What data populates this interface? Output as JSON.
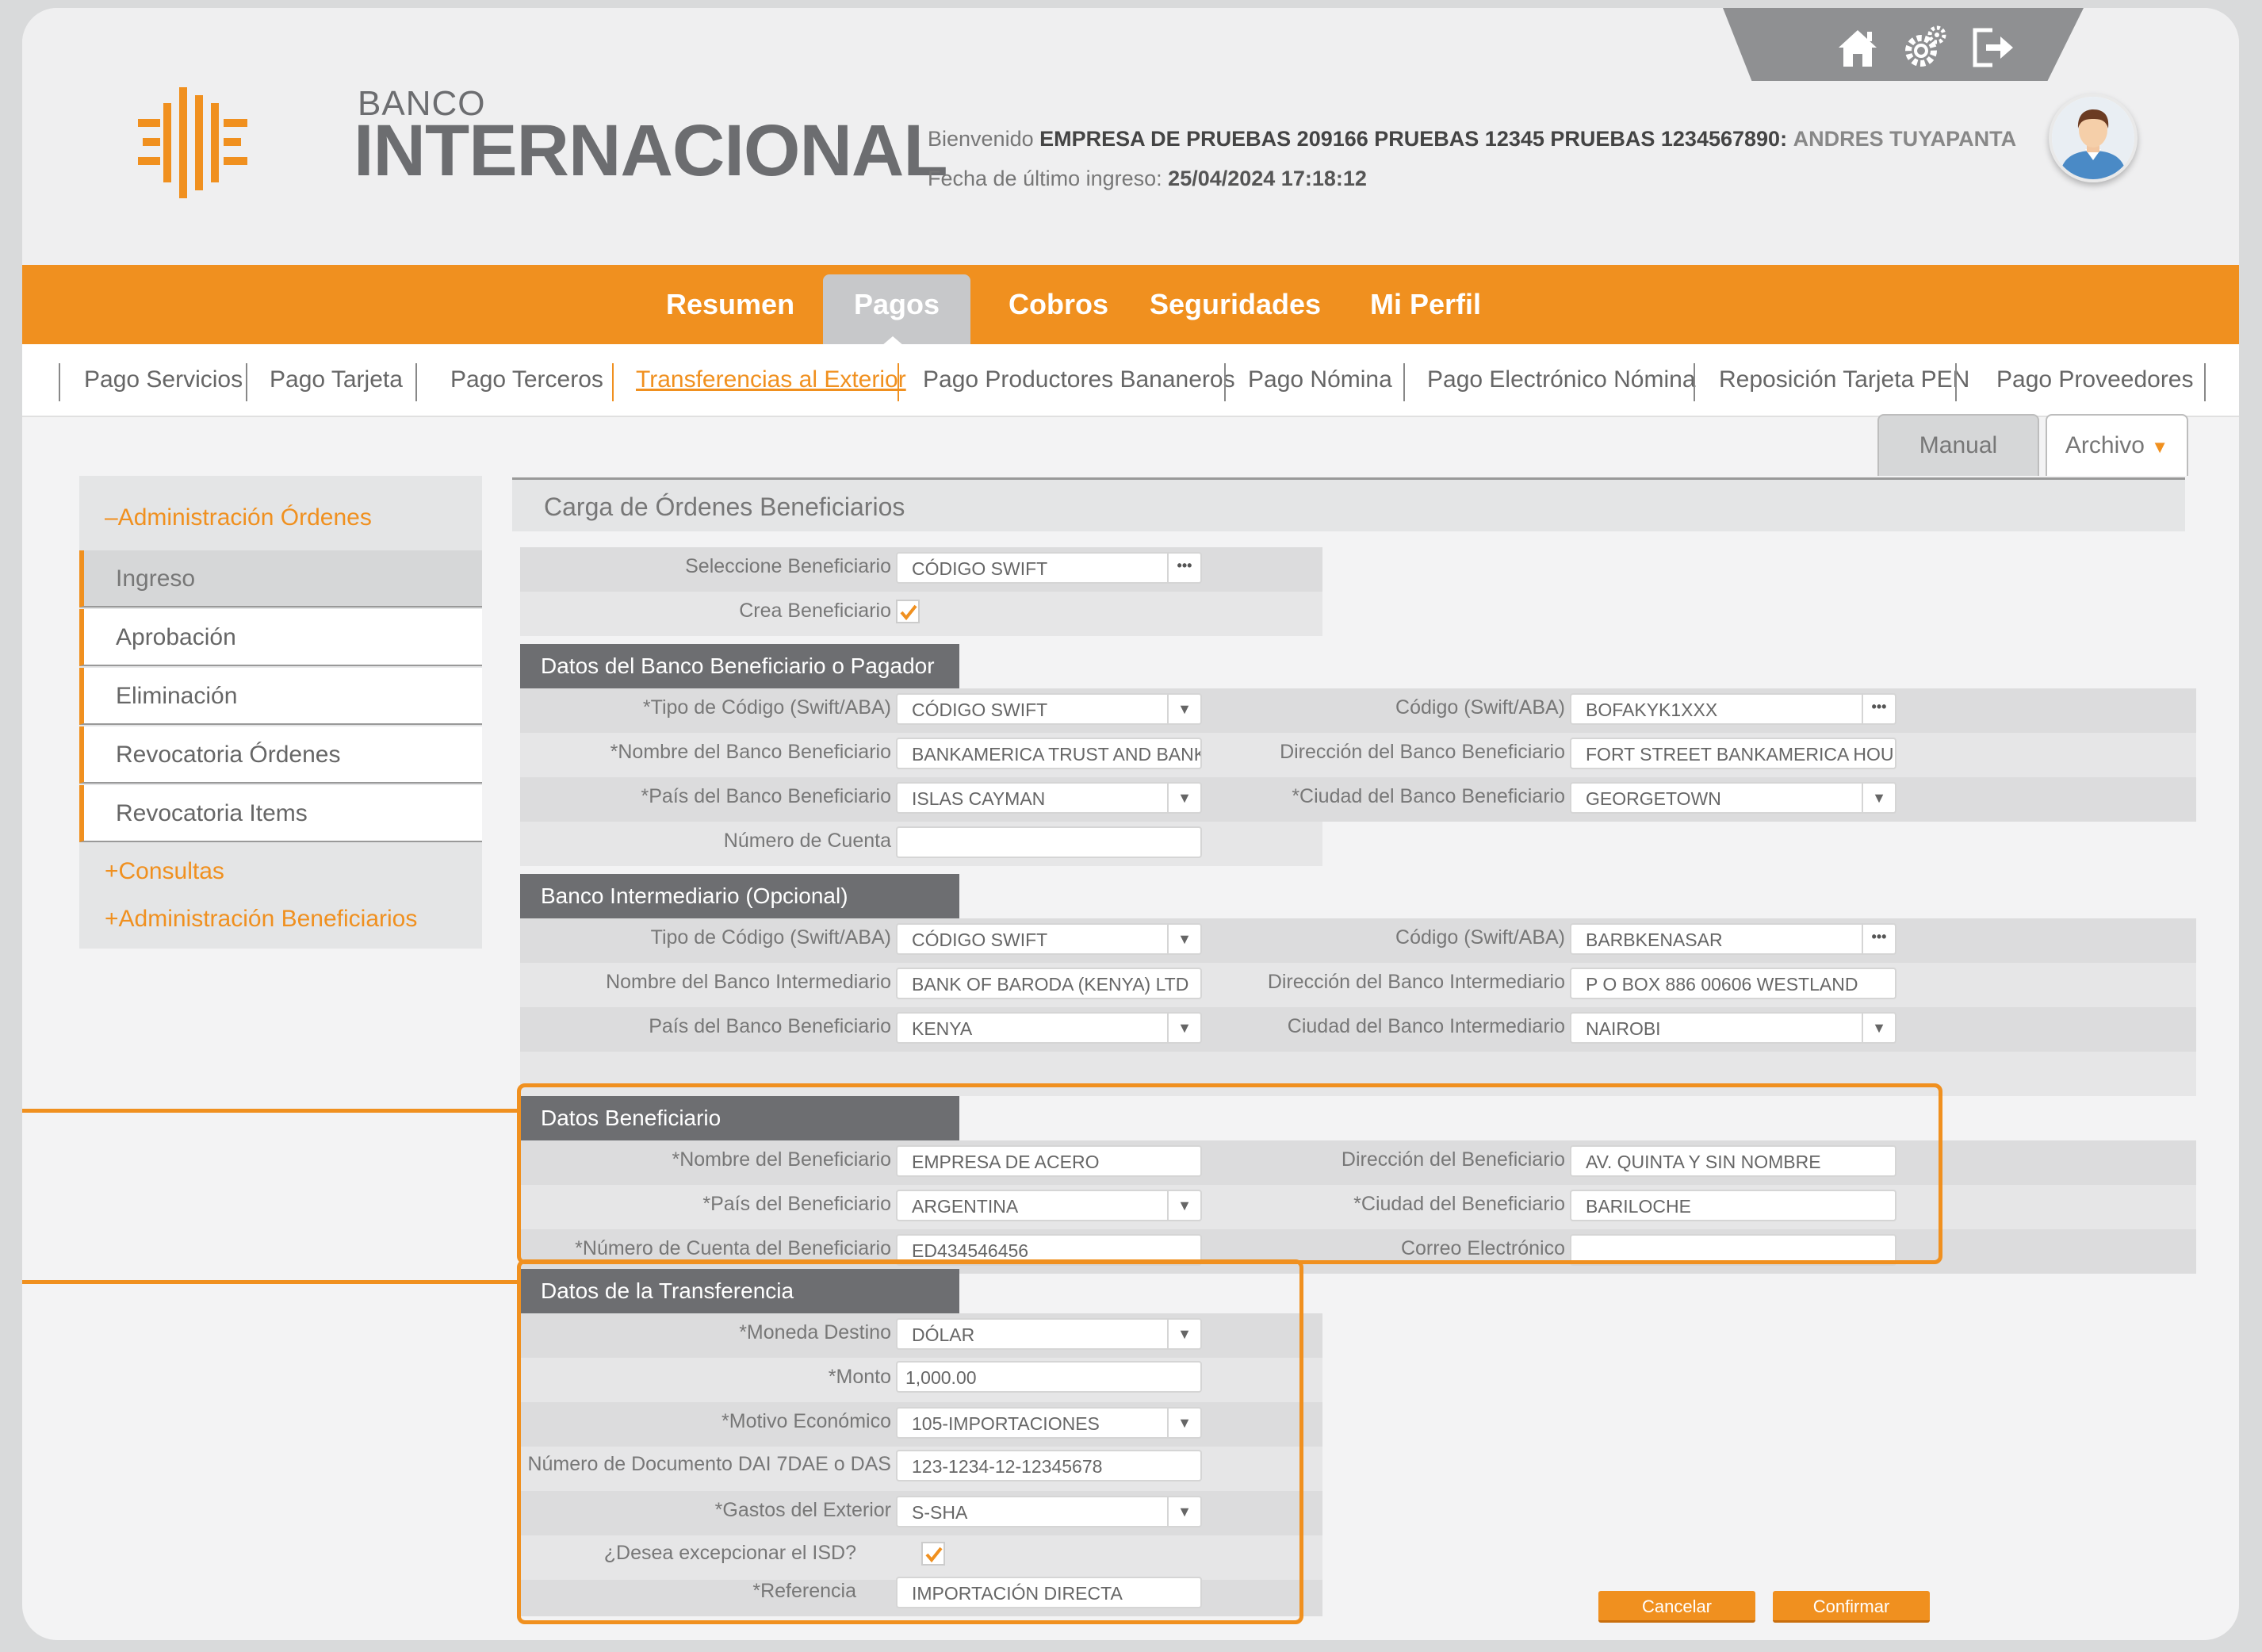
{
  "header": {
    "logo_top": "BANCO",
    "logo_name": "INTERNACIONAL",
    "welcome_prefix": "Bienvenido",
    "company": "EMPRESA DE PRUEBAS 209166 PRUEBAS 12345 PRUEBAS 1234567890:",
    "user": "ANDRES TUYAPANTA",
    "last_login_label": "Fecha de último ingreso:",
    "last_login_value": "25/04/2024 17:18:12",
    "icons": [
      "home-icon",
      "settings-icon",
      "logout-icon"
    ]
  },
  "main_nav": [
    "Resumen",
    "Pagos",
    "Cobros",
    "Seguridades",
    "Mi Perfil"
  ],
  "sub_nav": [
    "Pago Servicios",
    "Pago Tarjeta",
    "Pago Terceros",
    "Transferencias al Exterior",
    "Pago Productores Bananeros",
    "Pago Nómina",
    "Pago Electrónico Nómina",
    "Reposición Tarjeta PEN",
    "Pago Proveedores"
  ],
  "view_tabs": {
    "manual": "Manual",
    "archivo": "Archivo"
  },
  "sidebar": {
    "admin_ordenes": "–Administración Órdenes",
    "items": [
      "Ingreso",
      "Aprobación",
      "Eliminación",
      "Revocatoria Órdenes",
      "Revocatoria Items"
    ],
    "consultas": "+Consultas",
    "admin_beneficiarios": "+Administración Beneficiarios"
  },
  "content": {
    "title": "Carga de Órdenes Beneficiarios",
    "seleccione_label": "Seleccione Beneficiario",
    "seleccione_value": "CÓDIGO SWIFT",
    "crea_label": "Crea Beneficiario",
    "banco_beneficiario": {
      "heading": "Datos del Banco Beneficiario o Pagador",
      "tipo_label": "*Tipo de Código (Swift/ABA)",
      "tipo_value": "CÓDIGO SWIFT",
      "codigo_label": "Código (Swift/ABA)",
      "codigo_value": "BOFAKYK1XXX",
      "nombre_label": "*Nombre del Banco Beneficiario",
      "nombre_value": "BANKAMERICA TRUST AND BANKI",
      "direccion_label": "Dirección del Banco Beneficiario",
      "direccion_value": "FORT STREET BANKAMERICA HOU",
      "pais_label": "*País del Banco Beneficiario",
      "pais_value": "ISLAS CAYMAN",
      "ciudad_label": "*Ciudad del Banco Beneficiario",
      "ciudad_value": "GEORGETOWN",
      "cuenta_label": "Número de Cuenta",
      "cuenta_value": ""
    },
    "intermediario": {
      "heading": "Banco Intermediario (Opcional)",
      "tipo_label": "Tipo de Código (Swift/ABA)",
      "tipo_value": "CÓDIGO SWIFT",
      "codigo_label": "Código (Swift/ABA)",
      "codigo_value": "BARBKENASAR",
      "nombre_label": "Nombre del Banco Intermediario",
      "nombre_value": "BANK OF BARODA (KENYA) LTD",
      "direccion_label": "Dirección del Banco Intermediario",
      "direccion_value": "P O BOX 886 00606 WESTLAND",
      "pais_label": "País del Banco Beneficiario",
      "pais_value": "KENYA",
      "ciudad_label": "Ciudad del Banco Intermediario",
      "ciudad_value": "NAIROBI"
    },
    "beneficiario": {
      "heading": "Datos Beneficiario",
      "nombre_label": "*Nombre del Beneficiario",
      "nombre_value": "EMPRESA DE ACERO",
      "direccion_label": "Dirección del Beneficiario",
      "direccion_value": "AV. QUINTA Y SIN NOMBRE",
      "pais_label": "*País del Beneficiario",
      "pais_value": "ARGENTINA",
      "ciudad_label": "*Ciudad del Beneficiario",
      "ciudad_value": "BARILOCHE",
      "cuenta_label": "*Número de Cuenta del Beneficiario",
      "cuenta_value": "ED434546456",
      "correo_label": "Correo Electrónico",
      "correo_value": ""
    },
    "transferencia": {
      "heading": "Datos de la Transferencia",
      "moneda_label": "*Moneda Destino",
      "moneda_value": "DÓLAR",
      "monto_label": "*Monto",
      "monto_value": "1,000.00",
      "motivo_label": "*Motivo Económico",
      "motivo_value": "105-IMPORTACIONES",
      "documento_label": "Número de Documento DAI 7DAE o DAS",
      "documento_value": "123-1234-12-12345678",
      "gastos_label": "*Gastos del Exterior",
      "gastos_value": "S-SHA",
      "isd_label": "¿Desea excepcionar el ISD?",
      "referencia_label": "*Referencia",
      "referencia_value": "IMPORTACIÓN DIRECTA"
    },
    "buttons": {
      "cancel": "Cancelar",
      "confirm": "Confirmar"
    }
  },
  "colors": {
    "accent": "#f0901f",
    "section_header": "#6d6e71",
    "text": "#777777"
  }
}
